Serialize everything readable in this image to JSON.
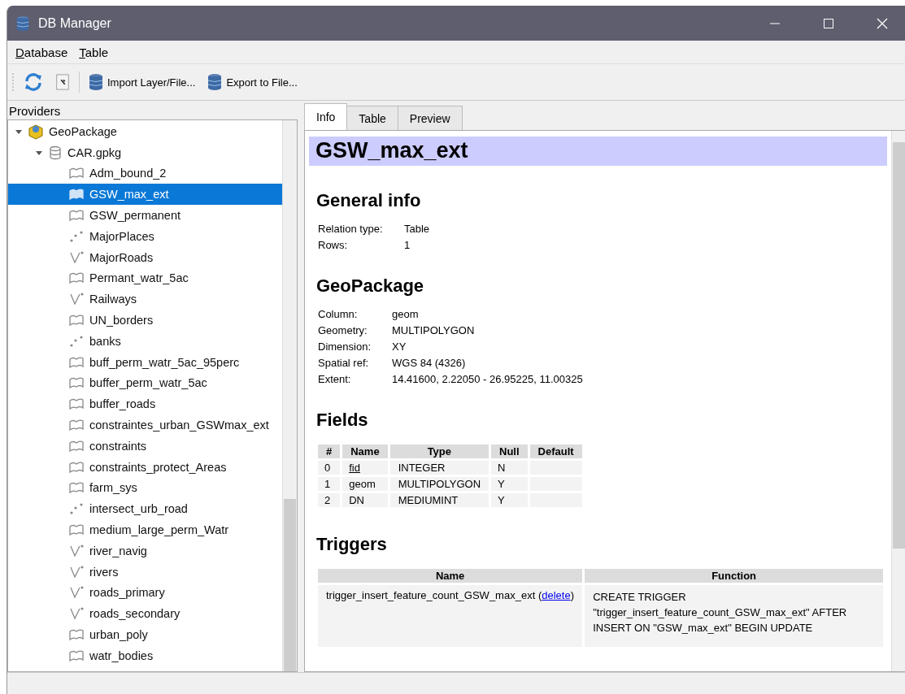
{
  "window": {
    "title": "DB Manager"
  },
  "menu": [
    "Database",
    "Table"
  ],
  "toolbar": [
    {
      "kind": "refresh"
    },
    {
      "kind": "info"
    },
    {
      "kind": "import",
      "label": "Import Layer/File..."
    },
    {
      "kind": "export",
      "label": "Export to File..."
    }
  ],
  "providers": {
    "title": "Providers",
    "tree": [
      {
        "label": "GeoPackage",
        "kind": "provider",
        "expanded": true,
        "selected": false,
        "children": [
          {
            "label": "CAR.gpkg",
            "kind": "database",
            "expanded": true,
            "selected": false,
            "children": [
              {
                "label": "Adm_bound_2",
                "kind": "polygon",
                "selected": false
              },
              {
                "label": "GSW_max_ext",
                "kind": "polygon",
                "selected": true
              },
              {
                "label": "GSW_permanent",
                "kind": "polygon",
                "selected": false
              },
              {
                "label": "MajorPlaces",
                "kind": "point",
                "selected": false
              },
              {
                "label": "MajorRoads",
                "kind": "line",
                "selected": false
              },
              {
                "label": "Permant_watr_5ac",
                "kind": "polygon",
                "selected": false
              },
              {
                "label": "Railways",
                "kind": "line",
                "selected": false
              },
              {
                "label": "UN_borders",
                "kind": "polygon",
                "selected": false
              },
              {
                "label": "banks",
                "kind": "point",
                "selected": false
              },
              {
                "label": "buff_perm_watr_5ac_95perc",
                "kind": "polygon",
                "selected": false
              },
              {
                "label": "buffer_perm_watr_5ac",
                "kind": "polygon",
                "selected": false
              },
              {
                "label": "buffer_roads",
                "kind": "polygon",
                "selected": false
              },
              {
                "label": "constraintes_urban_GSWmax_ext",
                "kind": "polygon",
                "selected": false
              },
              {
                "label": "constraints",
                "kind": "polygon",
                "selected": false
              },
              {
                "label": "constraints_protect_Areas",
                "kind": "polygon",
                "selected": false
              },
              {
                "label": "farm_sys",
                "kind": "polygon",
                "selected": false
              },
              {
                "label": "intersect_urb_road",
                "kind": "point",
                "selected": false
              },
              {
                "label": "medium_large_perm_Watr",
                "kind": "polygon",
                "selected": false
              },
              {
                "label": "river_navig",
                "kind": "line",
                "selected": false
              },
              {
                "label": "rivers",
                "kind": "line",
                "selected": false
              },
              {
                "label": "roads_primary",
                "kind": "line",
                "selected": false
              },
              {
                "label": "roads_secondary",
                "kind": "line",
                "selected": false
              },
              {
                "label": "urban_poly",
                "kind": "polygon",
                "selected": false
              },
              {
                "label": "watr_bodies",
                "kind": "polygon",
                "selected": false
              }
            ]
          }
        ]
      }
    ]
  },
  "tabs": [
    {
      "label": "Info",
      "selected": true
    },
    {
      "label": "Table",
      "selected": false
    },
    {
      "label": "Preview",
      "selected": false
    }
  ],
  "info": {
    "title": "GSW_max_ext",
    "sections": [
      {
        "heading": "General info",
        "kind": "props",
        "rows": [
          {
            "key": "Relation type:",
            "value": "Table"
          },
          {
            "key": "Rows:",
            "value": "1"
          }
        ]
      },
      {
        "heading": "GeoPackage",
        "kind": "props",
        "rows": [
          {
            "key": "Column:",
            "value": "geom"
          },
          {
            "key": "Geometry:",
            "value": "MULTIPOLYGON"
          },
          {
            "key": "Dimension:",
            "value": "XY"
          },
          {
            "key": "Spatial ref:",
            "value": "WGS 84 (4326)"
          },
          {
            "key": "Extent:",
            "value": "14.41600, 2.22050 - 26.95225, 11.00325"
          }
        ]
      },
      {
        "heading": "Fields",
        "kind": "fields",
        "columns": [
          "#",
          "Name",
          "Type",
          "Null",
          "Default"
        ],
        "rows": [
          {
            "num": "0",
            "name": "fid",
            "type": "INTEGER",
            "null": "N",
            "primary_key": true
          },
          {
            "num": "1",
            "name": "geom",
            "type": "MULTIPOLYGON",
            "null": "Y",
            "primary_key": false
          },
          {
            "num": "2",
            "name": "DN",
            "type": "MEDIUMINT",
            "null": "Y",
            "primary_key": false
          }
        ]
      },
      {
        "heading": "Triggers",
        "kind": "triggers",
        "columns": [
          "Name",
          "Function"
        ],
        "rows": [
          {
            "name": "trigger_insert_feature_count_GSW_max_ext",
            "link_before": "(",
            "link": "delete",
            "link_after": ")",
            "function": "CREATE TRIGGER \"trigger_insert_feature_count_GSW_max_ext\" AFTER INSERT ON \"GSW_max_ext\" BEGIN UPDATE"
          }
        ]
      }
    ]
  }
}
